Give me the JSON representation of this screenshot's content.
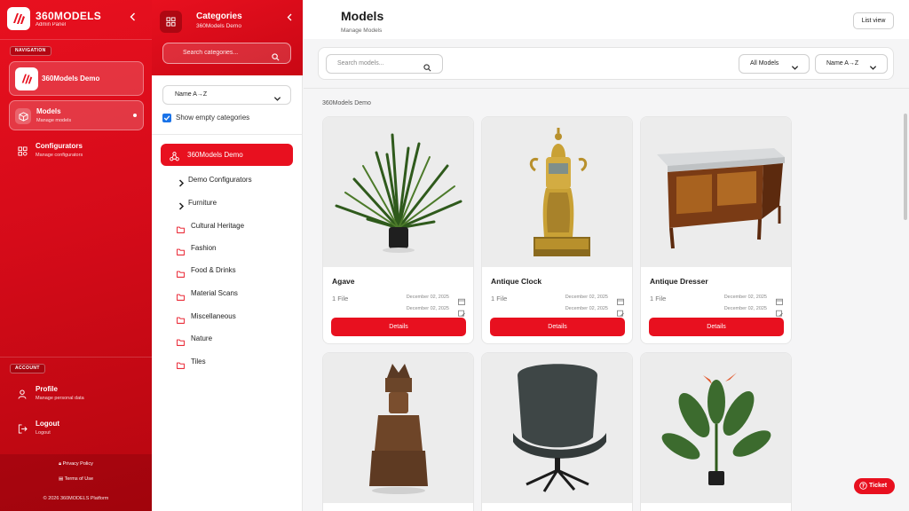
{
  "sidebar": {
    "brand_title": "360MODELS",
    "brand_sub": "Admin Panel",
    "navigation_label": "NAVIGATION",
    "project": "360Models Demo",
    "nav": [
      {
        "title": "Models",
        "sub": "Manage models",
        "icon": "cube-icon",
        "active": true
      },
      {
        "title": "Configurators",
        "sub": "Manage configurators",
        "icon": "configurator-icon",
        "active": false
      }
    ],
    "account_label": "ACCOUNT",
    "account": [
      {
        "title": "Profile",
        "sub": "Manage personal data",
        "icon": "user-icon"
      },
      {
        "title": "Logout",
        "sub": "Logout",
        "icon": "logout-icon"
      }
    ],
    "footer": {
      "privacy": "Privacy Policy",
      "terms": "Terms of Use",
      "copyright": "© 2026 360MODELS Platform"
    },
    "accent": "#e8101f"
  },
  "categories": {
    "title": "Categories",
    "sub": "360Models Demo",
    "search_placeholder": "Search categories...",
    "sort": "Name A→Z",
    "show_empty": "Show empty categories",
    "active": "360Models Demo",
    "items": [
      {
        "label": "Demo Configurators",
        "icon": "chevron-right-icon"
      },
      {
        "label": "Furniture",
        "icon": "chevron-right-icon"
      },
      {
        "label": "Cultural Heritage",
        "icon": "folder-icon"
      },
      {
        "label": "Fashion",
        "icon": "folder-icon"
      },
      {
        "label": "Food & Drinks",
        "icon": "folder-icon"
      },
      {
        "label": "Material Scans",
        "icon": "folder-icon"
      },
      {
        "label": "Miscellaneous",
        "icon": "folder-icon"
      },
      {
        "label": "Nature",
        "icon": "folder-icon"
      },
      {
        "label": "Tiles",
        "icon": "folder-icon"
      }
    ]
  },
  "main": {
    "title": "Models",
    "sub": "Manage Models",
    "list_view": "List view",
    "search_placeholder": "Search models...",
    "filter": "All Models",
    "sort": "Name A→Z",
    "group": "360Models Demo",
    "cards": [
      {
        "name": "Agave",
        "files": "1 File",
        "date1": "December 02, 2025",
        "date2": "December 02, 2025",
        "button": "Details"
      },
      {
        "name": "Antique Clock",
        "files": "1 File",
        "date1": "December 02, 2025",
        "date2": "December 02, 2025",
        "button": "Details"
      },
      {
        "name": "Antique Dresser",
        "files": "1 File",
        "date1": "December 02, 2025",
        "date2": "December 02, 2025",
        "button": "Details"
      },
      {
        "name": "",
        "files": "",
        "date1": "",
        "date2": "",
        "button": ""
      },
      {
        "name": "",
        "files": "",
        "date1": "",
        "date2": "",
        "button": ""
      },
      {
        "name": "",
        "files": "",
        "date1": "",
        "date2": "",
        "button": ""
      }
    ],
    "ticket": "Ticket"
  }
}
